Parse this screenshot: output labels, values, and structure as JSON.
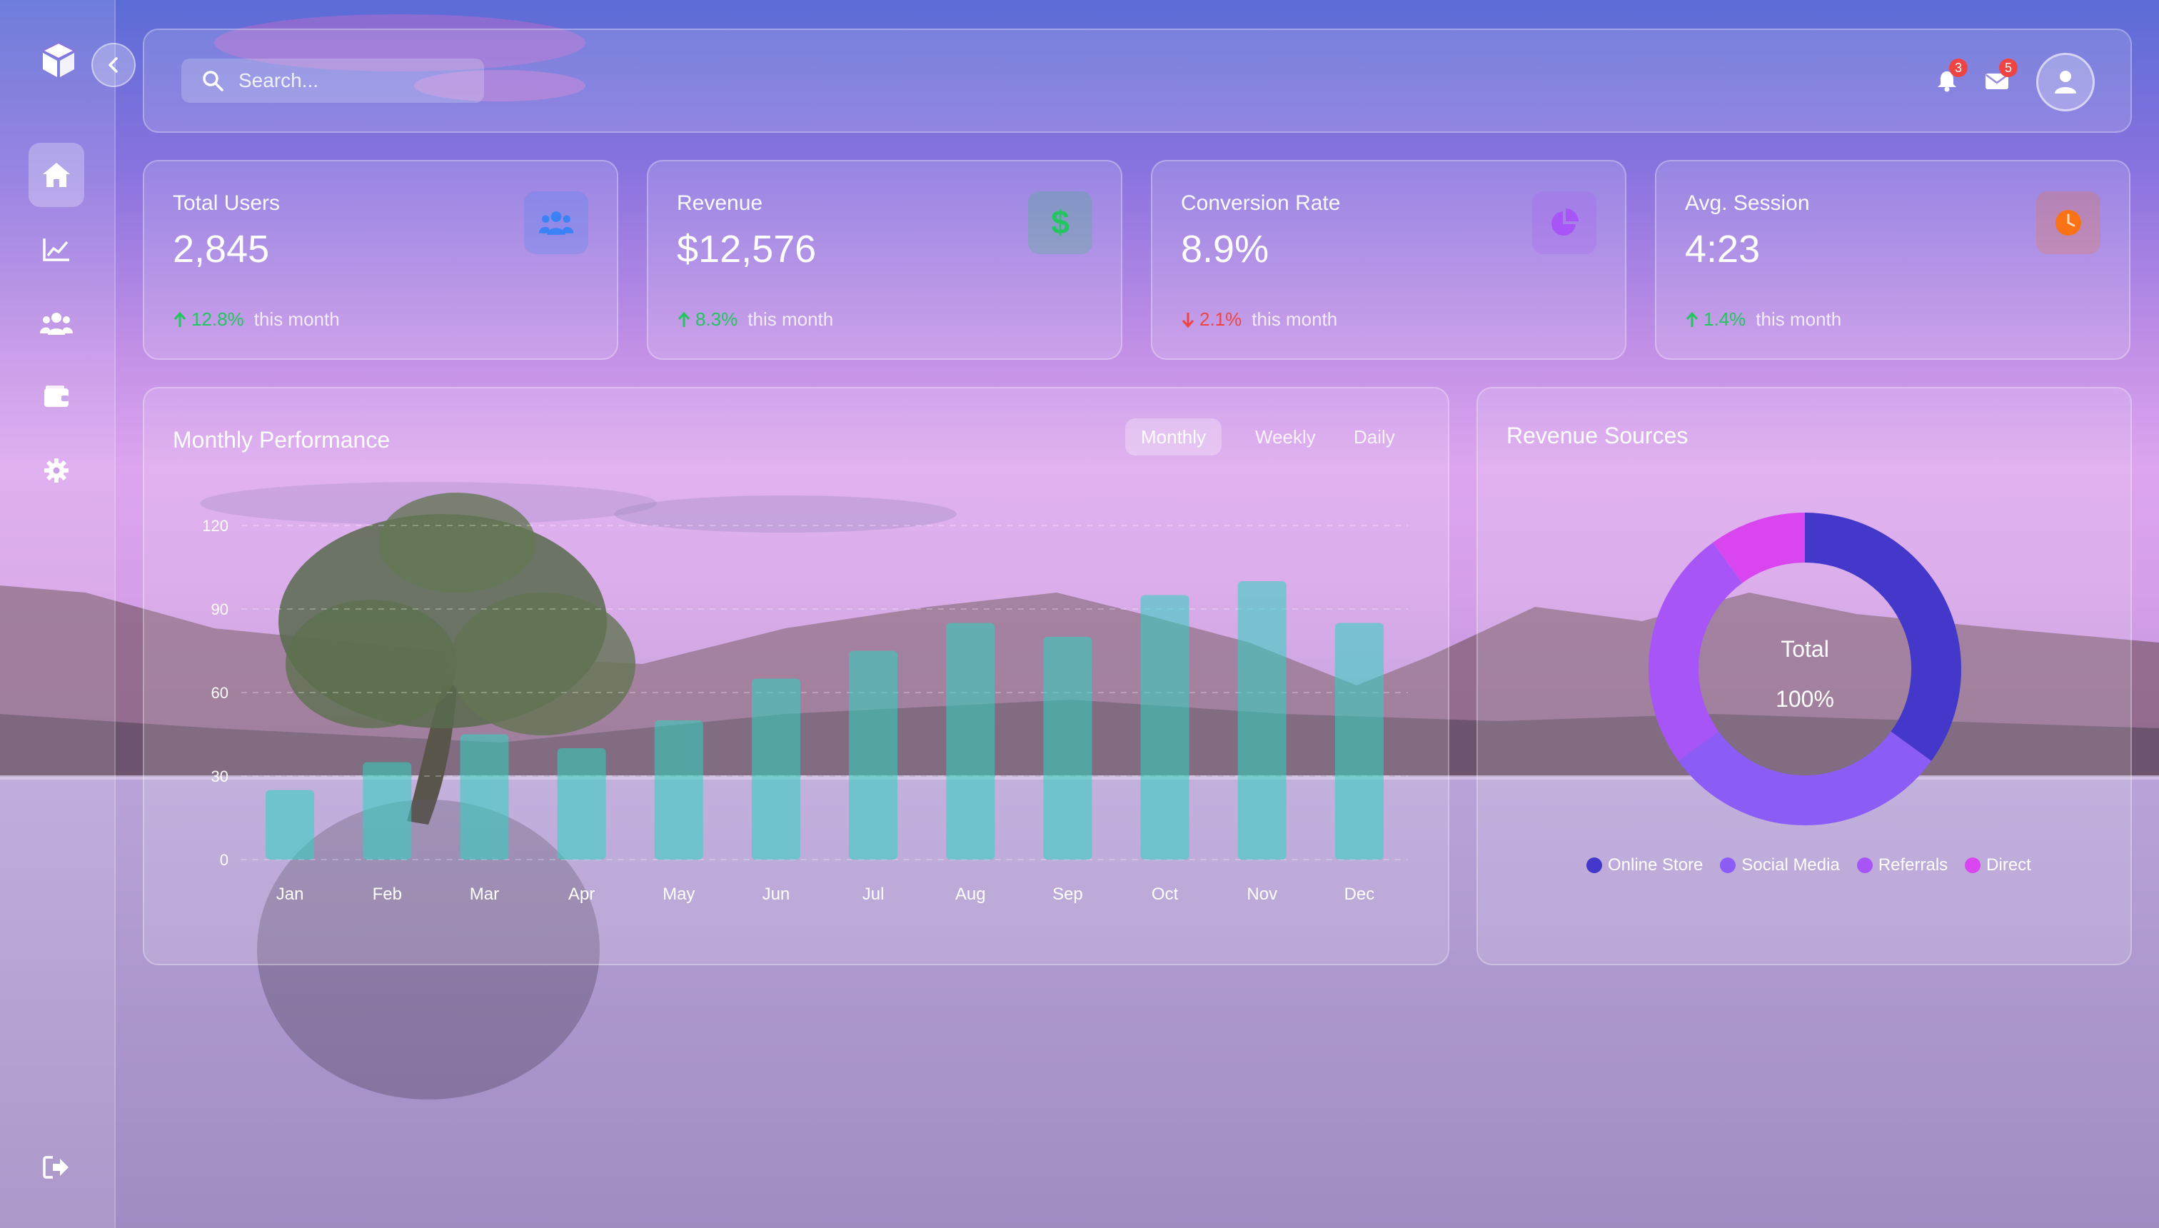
{
  "search": {
    "placeholder": "Search..."
  },
  "header": {
    "notifications_count": "3",
    "messages_count": "5"
  },
  "sidebar": {
    "items": [
      {
        "icon": "home-icon",
        "active": true
      },
      {
        "icon": "chart-line-icon",
        "active": false
      },
      {
        "icon": "users-icon",
        "active": false
      },
      {
        "icon": "wallet-icon",
        "active": false
      },
      {
        "icon": "gear-icon",
        "active": false
      }
    ],
    "logout_icon": "logout-icon"
  },
  "stats": [
    {
      "title": "Total Users",
      "value": "2,845",
      "change": "12.8%",
      "direction": "up",
      "suffix": "this month",
      "icon": "users-icon",
      "icon_color": "#3b82f6"
    },
    {
      "title": "Revenue",
      "value": "$12,576",
      "change": "8.3%",
      "direction": "up",
      "suffix": "this month",
      "icon": "dollar-icon",
      "icon_color": "#22c55e"
    },
    {
      "title": "Conversion Rate",
      "value": "8.9%",
      "change": "2.1%",
      "direction": "down",
      "suffix": "this month",
      "icon": "pie-chart-icon",
      "icon_color": "#a855f7"
    },
    {
      "title": "Avg. Session",
      "value": "4:23",
      "change": "1.4%",
      "direction": "up",
      "suffix": "this month",
      "icon": "clock-icon",
      "icon_color": "#f97316"
    }
  ],
  "performance": {
    "title": "Monthly Performance",
    "tabs": [
      "Monthly",
      "Weekly",
      "Daily"
    ],
    "active_tab": "Monthly"
  },
  "revenue_sources": {
    "title": "Revenue Sources",
    "center_label": "Total",
    "center_value": "100%"
  },
  "chart_data": [
    {
      "type": "bar",
      "categories": [
        "Jan",
        "Feb",
        "Mar",
        "Apr",
        "May",
        "Jun",
        "Jul",
        "Aug",
        "Sep",
        "Oct",
        "Nov",
        "Dec"
      ],
      "values": [
        25,
        35,
        45,
        40,
        50,
        65,
        75,
        85,
        80,
        95,
        100,
        85
      ],
      "ylim": [
        0,
        120
      ],
      "yticks": [
        0,
        30,
        60,
        90,
        120
      ],
      "grid": true,
      "bar_color": "#2dd4bf"
    },
    {
      "type": "pie",
      "categories": [
        "Online Store",
        "Social Media",
        "Referrals",
        "Direct"
      ],
      "values": [
        35,
        30,
        25,
        10
      ],
      "colors": [
        "#4338ca",
        "#8b5cf6",
        "#a855f7",
        "#d946ef"
      ],
      "legend": "bottom"
    }
  ]
}
